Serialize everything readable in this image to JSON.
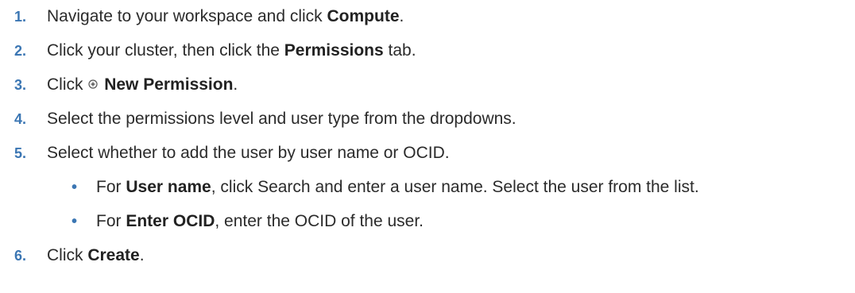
{
  "steps": [
    {
      "num": "1.",
      "pre": "Navigate to your workspace and click ",
      "bold": "Compute",
      "post": "."
    },
    {
      "num": "2.",
      "pre": "Click your cluster, then click the ",
      "bold": "Permissions",
      "post": " tab."
    },
    {
      "num": "3.",
      "pre": "Click ",
      "icon": "add-circle-icon",
      "bold": "New Permission",
      "post": "."
    },
    {
      "num": "4.",
      "pre": "Select the permissions level and user type from the dropdowns."
    },
    {
      "num": "5.",
      "pre": "Select whether to add the user by user name or OCID."
    },
    {
      "num": "6.",
      "pre": "Click ",
      "bold": "Create",
      "post": "."
    }
  ],
  "substeps": [
    {
      "bullet": "•",
      "pre": "For ",
      "bold": "User name",
      "post": ", click Search and enter a user name. Select the user from the list."
    },
    {
      "bullet": "•",
      "pre": "For ",
      "bold": "Enter OCID",
      "post": ", enter the OCID of the user."
    }
  ],
  "colors": {
    "step_number": "#3b76b3",
    "text": "#2b2b2b"
  }
}
